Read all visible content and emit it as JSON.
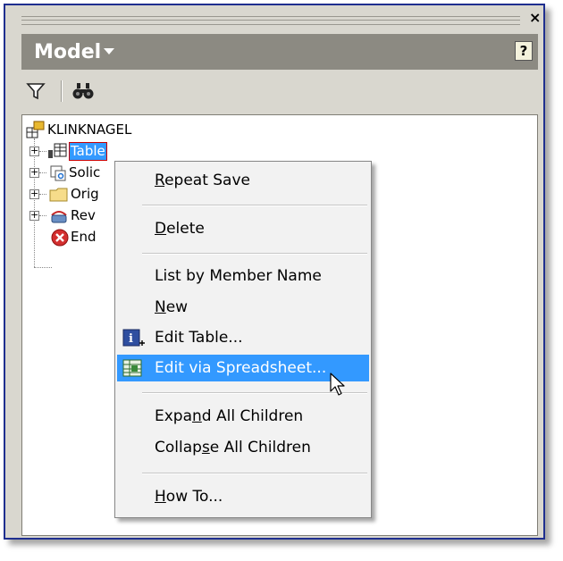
{
  "panel": {
    "close_glyph": "×",
    "title": "Model",
    "help_glyph": "?",
    "toolbar": {
      "filter_icon": "filter-icon",
      "find_icon": "binoculars-icon"
    }
  },
  "tree": {
    "root": {
      "label": "KLINKNAGEL",
      "icon": "assembly-icon"
    },
    "children": [
      {
        "label": "Table",
        "icon": "table-icon",
        "selected": true,
        "expander": "+"
      },
      {
        "label": "Solic",
        "icon": "solid-bodies-icon",
        "expander": "+"
      },
      {
        "label": "Orig",
        "icon": "folder-icon",
        "expander": "+"
      },
      {
        "label": "Rev",
        "icon": "revolve-icon",
        "expander": "+"
      },
      {
        "label": "End",
        "icon": "end-of-part-icon"
      }
    ]
  },
  "context_menu": {
    "items": [
      {
        "pre": "",
        "u": "R",
        "post": "epeat Save"
      },
      {
        "pre": "",
        "u": "D",
        "post": "elete"
      },
      {
        "pre": "List by Member Name",
        "u": "",
        "post": ""
      },
      {
        "pre": "",
        "u": "N",
        "post": "ew"
      },
      {
        "pre": "Edit Table...",
        "u": "",
        "post": ""
      },
      {
        "pre": "Edit via Spreadsheet...",
        "u": "",
        "post": ""
      },
      {
        "pre": "Expa",
        "u": "n",
        "post": "d All Children"
      },
      {
        "pre": "Collap",
        "u": "s",
        "post": "e All Children"
      },
      {
        "pre": "",
        "u": "H",
        "post": "ow To..."
      }
    ],
    "highlighted_index": 5
  },
  "colors": {
    "highlight": "#3399ff",
    "title_bar": "#8c8a82",
    "frame_border": "#1f2f8f"
  }
}
